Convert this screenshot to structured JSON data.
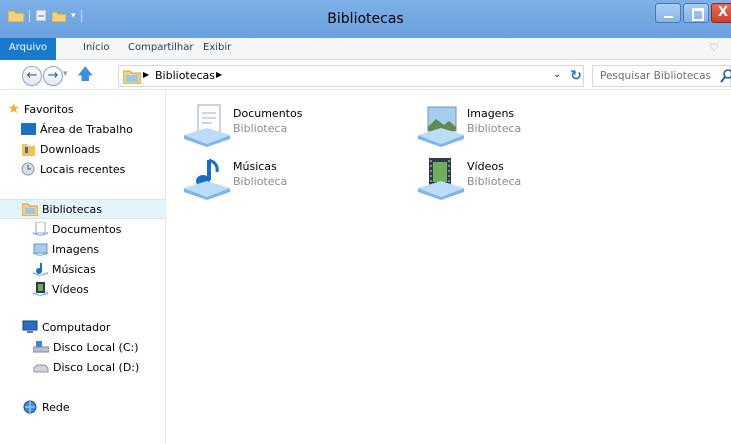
{
  "window": {
    "title": "Bibliotecas",
    "close_glyph": "X"
  },
  "ribbon": {
    "tabs": [
      "Arquivo",
      "Início",
      "Compartilhar",
      "Exibir"
    ],
    "collapse_glyph": "♡"
  },
  "address": {
    "back_glyph": "←",
    "forward_glyph": "→",
    "path": "Bibliotecas",
    "search_placeholder": "Pesquisar Bibliotecas"
  },
  "navigation": {
    "favorites": {
      "label": "Favoritos",
      "items": [
        "Área de Trabalho",
        "Downloads",
        "Locais recentes"
      ]
    },
    "libraries": {
      "label": "Bibliotecas",
      "items": [
        "Documentos",
        "Imagens",
        "Músicas",
        "Vídeos"
      ]
    },
    "computer": {
      "label": "Computador",
      "items": [
        "Disco Local (C:)",
        "Disco Local (D:)"
      ]
    },
    "network": {
      "label": "Rede"
    }
  },
  "libraries": [
    {
      "name": "Documentos",
      "type": "Biblioteca",
      "icon": "documents-library-icon"
    },
    {
      "name": "Imagens",
      "type": "Biblioteca",
      "icon": "pictures-library-icon"
    },
    {
      "name": "Músicas",
      "type": "Biblioteca",
      "icon": "music-library-icon"
    },
    {
      "name": "Vídeos",
      "type": "Biblioteca",
      "icon": "videos-library-icon"
    }
  ],
  "colors": {
    "titlebar": "#6aa0de",
    "file_tab": "#1979ca",
    "selection": "#e5f3fb",
    "close_button": "#c7412f"
  }
}
